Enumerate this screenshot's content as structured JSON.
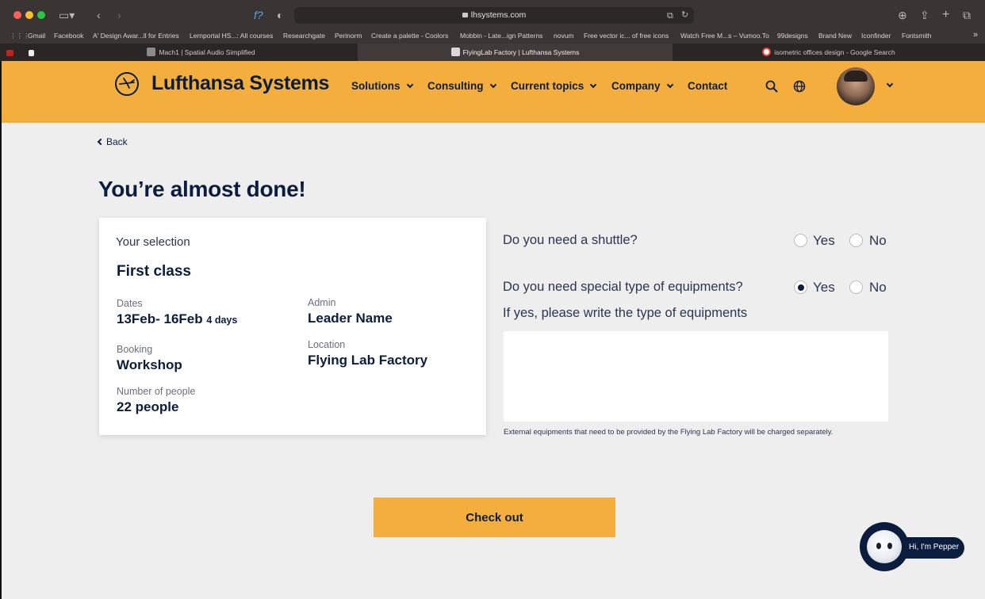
{
  "browser": {
    "url": "lhsystems.com",
    "bookmarks": [
      "Gmail",
      "Facebook",
      "A' Design Awar...ll for Entries",
      "Lernportal HS...: All courses",
      "Researchgate",
      "Perinorm",
      "Create a palette - Coolors",
      "Mobbin - Late...ign Patterns",
      "novum",
      "Free vector ic... of free icons",
      "Watch Free M...s – Vumoo.To",
      "99designs",
      "Brand New",
      "Iconfinder",
      "Fontsmith"
    ],
    "tabs": [
      {
        "label": "Mach1 | Spatial Audio Simplified",
        "active": false
      },
      {
        "label": "FlyingLab Factory | Lufthansa Systems",
        "active": true
      },
      {
        "label": "isometric offices design - Google Search",
        "active": false
      }
    ]
  },
  "header": {
    "logo": "Lufthansa Systems",
    "nav": [
      "Solutions",
      "Consulting",
      "Current topics",
      "Company",
      "Contact"
    ]
  },
  "page": {
    "back": "Back",
    "title": "You’re almost done!"
  },
  "selection": {
    "heading": "Your selection",
    "class_name": "First class",
    "dates_label": "Dates",
    "dates_value": "13Feb- 16Feb",
    "dates_duration": "4 days",
    "admin_label": "Admin",
    "admin_value": "Leader Name",
    "booking_label": "Booking",
    "booking_value": "Workshop",
    "location_label": "Location",
    "location_value": "Flying Lab Factory",
    "people_label": "Number of people",
    "people_value": "22 people"
  },
  "form": {
    "shuttle_question": "Do you need a shuttle?",
    "equipment_question": "Do you need special type of equipments?",
    "yes": "Yes",
    "no": "No",
    "shuttle_selected": "none",
    "equipment_selected": "yes",
    "equipment_prompt": "If yes, please write the type of equipments",
    "equipment_value": "",
    "equipment_hint": "External equipments that need to be provided by the Flying Lab Factory will be charged separately."
  },
  "checkout": {
    "label": "Check out"
  },
  "assistant": {
    "label": "Hi, I'm Pepper"
  },
  "colors": {
    "brand_yellow": "#f4ae3d",
    "navy": "#0b1d3f",
    "background": "#eeeeee"
  }
}
